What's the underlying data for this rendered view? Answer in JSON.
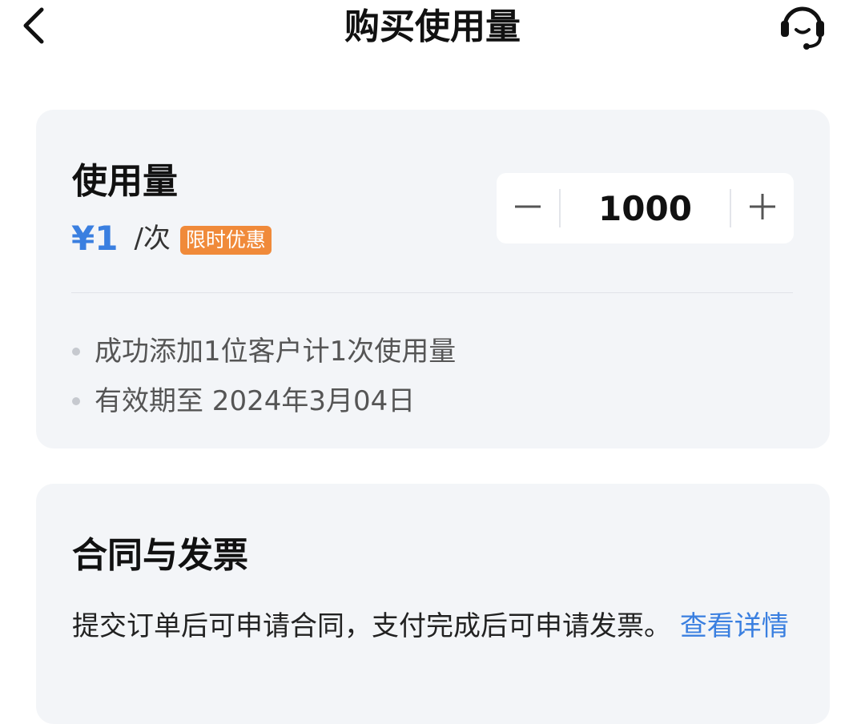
{
  "header": {
    "title": "购买使用量",
    "back_icon": "chevron-left-icon",
    "support_icon": "headset-icon"
  },
  "usage": {
    "title": "使用量",
    "price": "¥1",
    "unit": "/次",
    "promo_badge": "限时优惠",
    "quantity": "1000",
    "notes": [
      "成功添加1位客户计1次使用量",
      "有效期至 2024年3月04日"
    ]
  },
  "contract": {
    "title": "合同与发票",
    "description": "提交订单后可申请合同，支付完成后可申请发票。",
    "detail_link": "查看详情"
  },
  "colors": {
    "accent": "#3a7fe0",
    "promo": "#f08a3a",
    "card_bg": "#f3f5f8"
  }
}
